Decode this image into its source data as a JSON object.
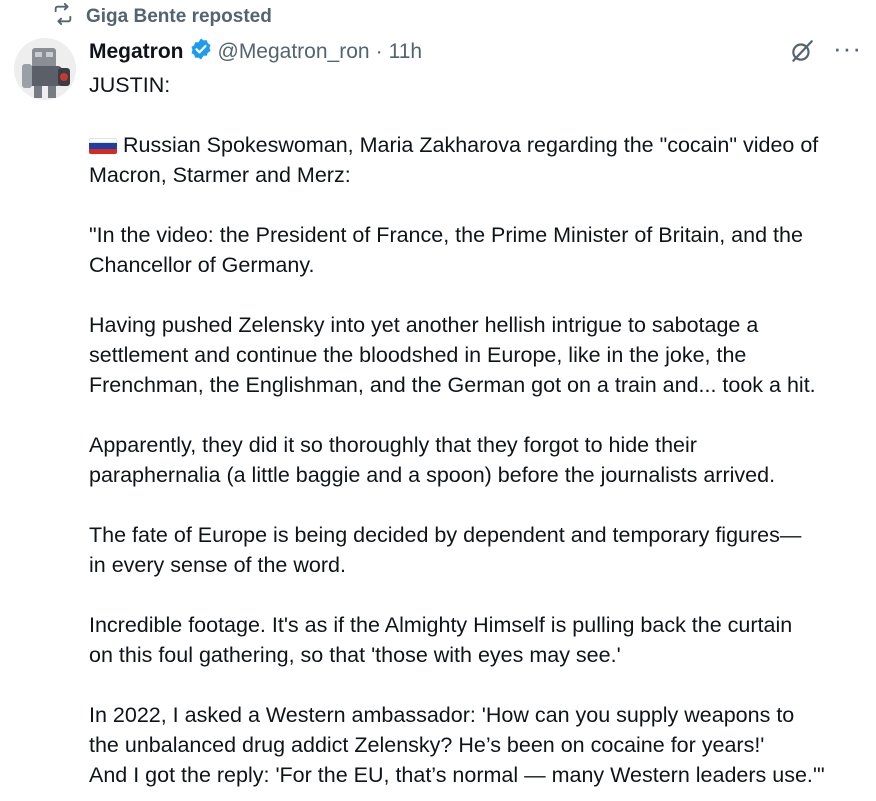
{
  "repost": {
    "label": "Giga Bente reposted"
  },
  "author": {
    "name": "Megatron",
    "handle": "@Megatron_ron",
    "separator": "·",
    "time": "11h"
  },
  "post": {
    "lines": {
      "l1": "JUSTIN:",
      "l2": "Russian Spokeswoman, Maria Zakharova regarding the \"cocain\" video of",
      "l3": "Macron, Starmer and Merz:",
      "l4": "\"In the video: the President of France, the Prime Minister of Britain, and the",
      "l5": "Chancellor of Germany.",
      "l6": "Having pushed Zelensky into yet another hellish intrigue to sabotage a",
      "l7": "settlement and continue the bloodshed in Europe, like in the joke, the",
      "l8": "Frenchman, the Englishman, and the German got on a train and... took a hit.",
      "l9": "Apparently, they did it so thoroughly that they forgot to hide their",
      "l10": "paraphernalia (a little baggie and a spoon) before the journalists arrived.",
      "l11": "The fate of Europe is being decided by dependent and temporary figures—",
      "l12": "in every sense of the word.",
      "l13": "Incredible footage. It's as if the Almighty Himself is pulling back the curtain",
      "l14": "on this foul gathering, so that 'those with eyes may see.'",
      "l15": "In 2022, I asked a Western ambassador: 'How can you supply weapons to",
      "l16": "the unbalanced drug addict Zelensky? He’s been on cocaine for years!'",
      "l17": "And I got the reply: 'For the EU, that’s normal — many Western leaders use.'\""
    }
  },
  "icons": {
    "repost": "repost-icon",
    "verified": "verified-badge-icon",
    "grok": "grok-icon",
    "more": "more-options-icon",
    "flag": "russia-flag-icon"
  },
  "colors": {
    "text": "#0f1419",
    "secondary": "#536471",
    "verified": "#1d9bf0",
    "flag_white": "#ffffff",
    "flag_blue": "#1c3fa8",
    "flag_red": "#d52b1e"
  }
}
